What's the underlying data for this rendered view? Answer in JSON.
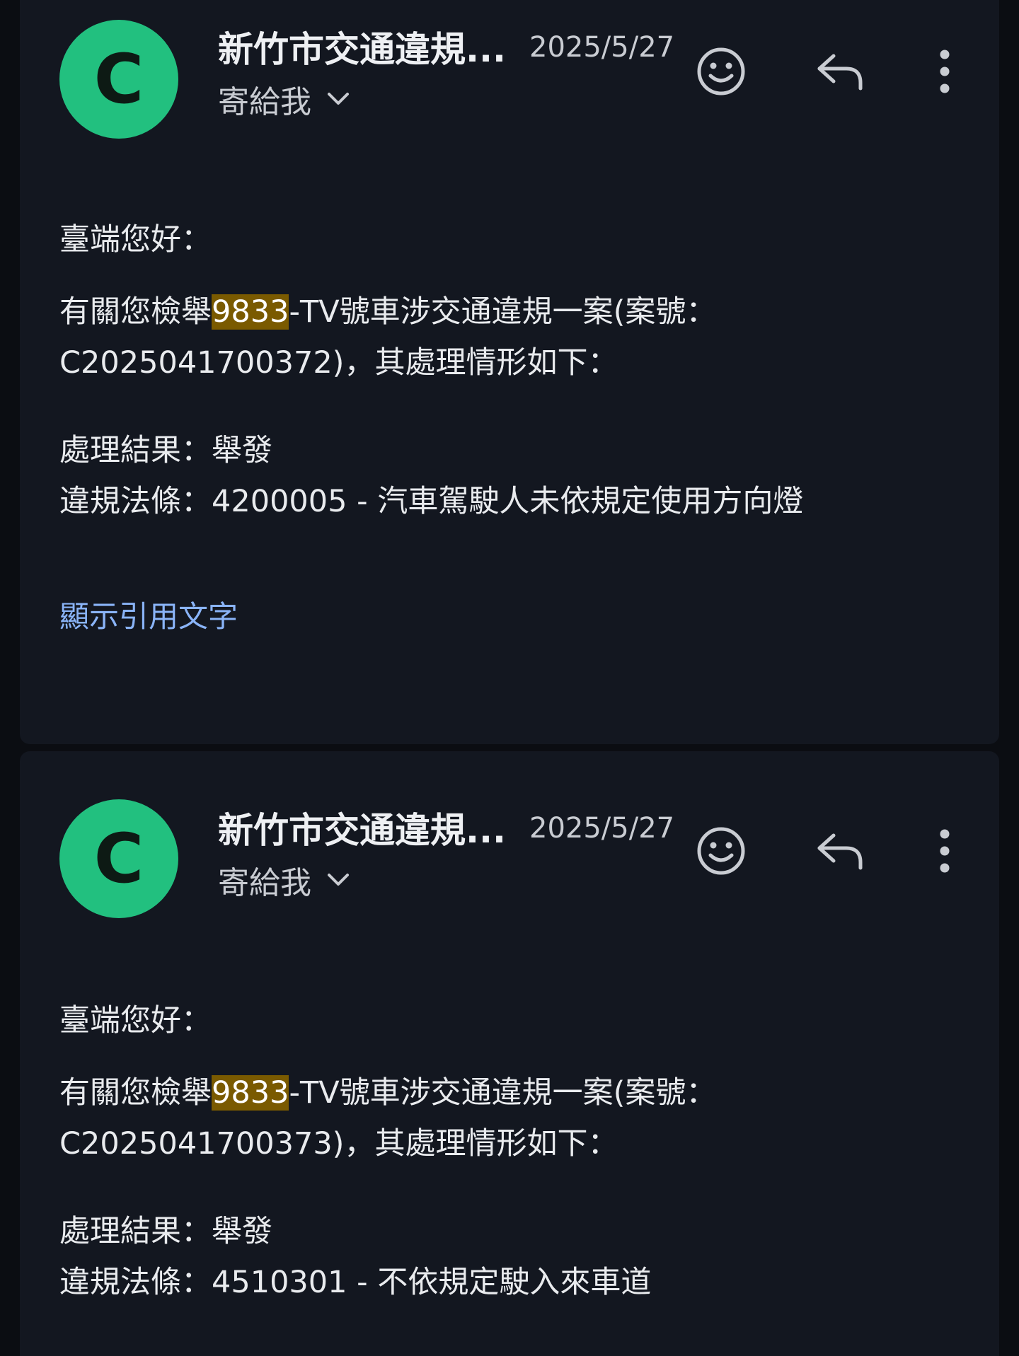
{
  "emails": [
    {
      "avatar_letter": "C",
      "sender": "新竹市交通違規...",
      "date": "2025/5/27",
      "recipient": "寄給我",
      "greeting": "臺端您好：",
      "line1_pre": "有關您檢舉",
      "line1_highlight": "9833",
      "line1_post": "-TV號車涉交通違規一案(案號：",
      "line2": "C2025041700372)，其處理情形如下：",
      "result": "處理結果：舉發",
      "law": "違規法條：4200005 - 汽車駕駛人未依規定使用方向燈",
      "show_quoted": "顯示引用文字"
    },
    {
      "avatar_letter": "C",
      "sender": "新竹市交通違規...",
      "date": "2025/5/27",
      "recipient": "寄給我",
      "greeting": "臺端您好：",
      "line1_pre": "有關您檢舉",
      "line1_highlight": "9833",
      "line1_post": "-TV號車涉交通違規一案(案號：",
      "line2": "C2025041700373)，其處理情形如下：",
      "result": "處理結果：舉發",
      "law": "違規法條：4510301 - 不依規定駛入來車道"
    }
  ],
  "icons": {
    "emoji": "smiley-icon",
    "reply": "reply-icon",
    "more": "more-vert-icon",
    "expand": "chevron-down-icon"
  },
  "colors": {
    "avatar": "#22c07f",
    "highlight": "#7a5a00",
    "link": "#8ab4f8",
    "card": "#131720",
    "background": "#0b0d12"
  }
}
